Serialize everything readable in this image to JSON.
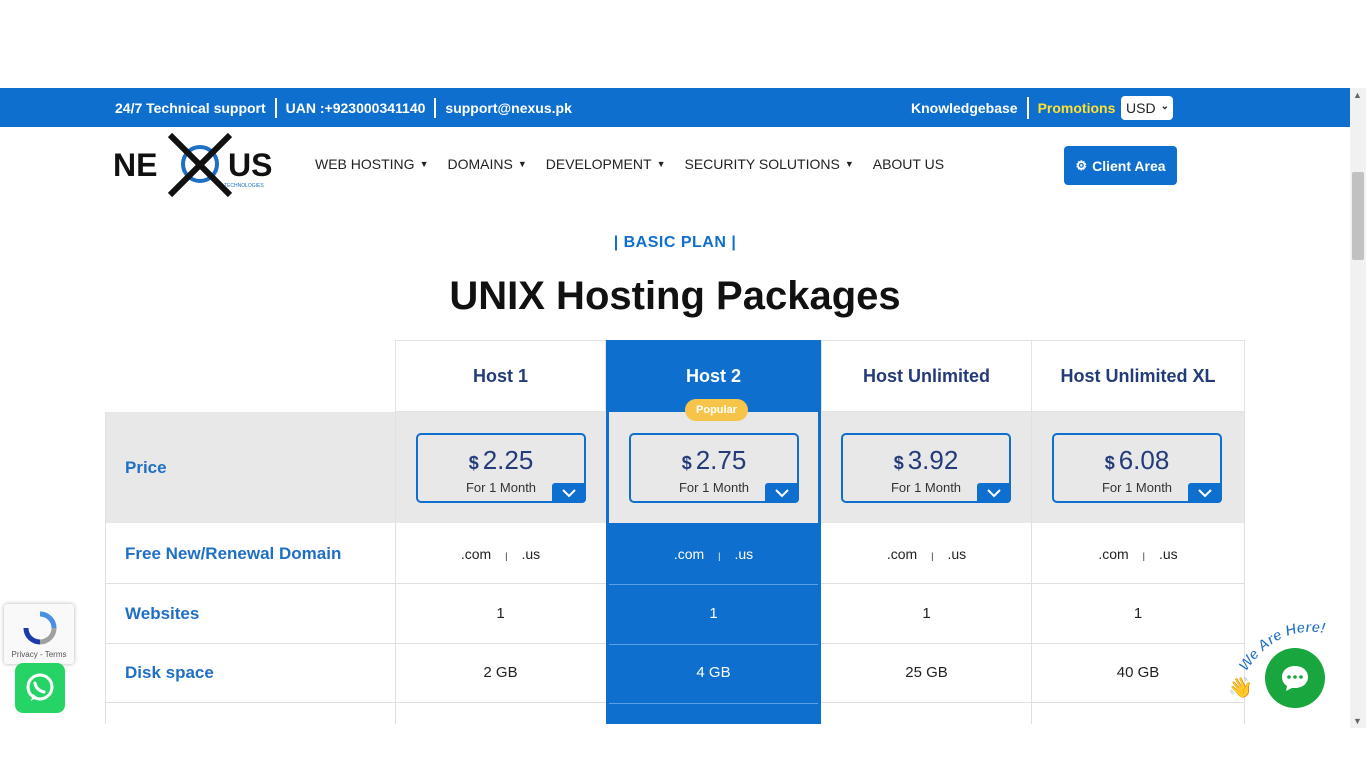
{
  "topbar": {
    "support": "24/7 Technical support",
    "uan": "UAN :+923000341140",
    "email": "support@nexus.pk",
    "knowledgebase": "Knowledgebase",
    "promotions": "Promotions",
    "currency": "USD"
  },
  "logo": {
    "text_left": "NE",
    "text_right": "US",
    "sub": "TECHNOLOGIES"
  },
  "nav": [
    {
      "label": "WEB HOSTING"
    },
    {
      "label": "DOMAINS"
    },
    {
      "label": "DEVELOPMENT"
    },
    {
      "label": "SECURITY SOLUTIONS"
    },
    {
      "label": "ABOUT US"
    }
  ],
  "client_area": "Client Area",
  "section": {
    "eyebrow": "| BASIC PLAN |",
    "title": "UNIX Hosting Packages"
  },
  "plans": [
    {
      "name": "Host 1",
      "currency": "$",
      "price": "2.25",
      "period": "For 1 Month",
      "domain_a": ".com",
      "domain_sep": "|",
      "domain_b": ".us",
      "websites": "1",
      "disk": "2 GB"
    },
    {
      "name": "Host 2",
      "currency": "$",
      "price": "2.75",
      "period": "For 1 Month",
      "domain_a": ".com",
      "domain_sep": "|",
      "domain_b": ".us",
      "websites": "1",
      "disk": "4 GB",
      "badge": "Popular"
    },
    {
      "name": "Host Unlimited",
      "currency": "$",
      "price": "3.92",
      "period": "For 1 Month",
      "domain_a": ".com",
      "domain_sep": "|",
      "domain_b": ".us",
      "websites": "1",
      "disk": "25 GB"
    },
    {
      "name": "Host Unlimited XL",
      "currency": "$",
      "price": "6.08",
      "period": "For 1 Month",
      "domain_a": ".com",
      "domain_sep": "|",
      "domain_b": ".us",
      "websites": "1",
      "disk": "40 GB"
    }
  ],
  "rows": {
    "price": "Price",
    "domain": "Free New/Renewal Domain",
    "websites": "Websites",
    "disk": "Disk space"
  },
  "recaptcha": "Privacy - Terms",
  "chat_badge": "We Are Here!",
  "colors": {
    "brand": "#0f6fce",
    "promo": "#ffe030",
    "popular": "#f7c44a",
    "whatsapp": "#25d366",
    "chat": "#19a63e"
  },
  "icons": [
    "gear-icon",
    "caret-down-icon",
    "chevron-down-icon",
    "whatsapp-icon",
    "chat-icon",
    "recaptcha-icon",
    "wave-hand-icon"
  ]
}
